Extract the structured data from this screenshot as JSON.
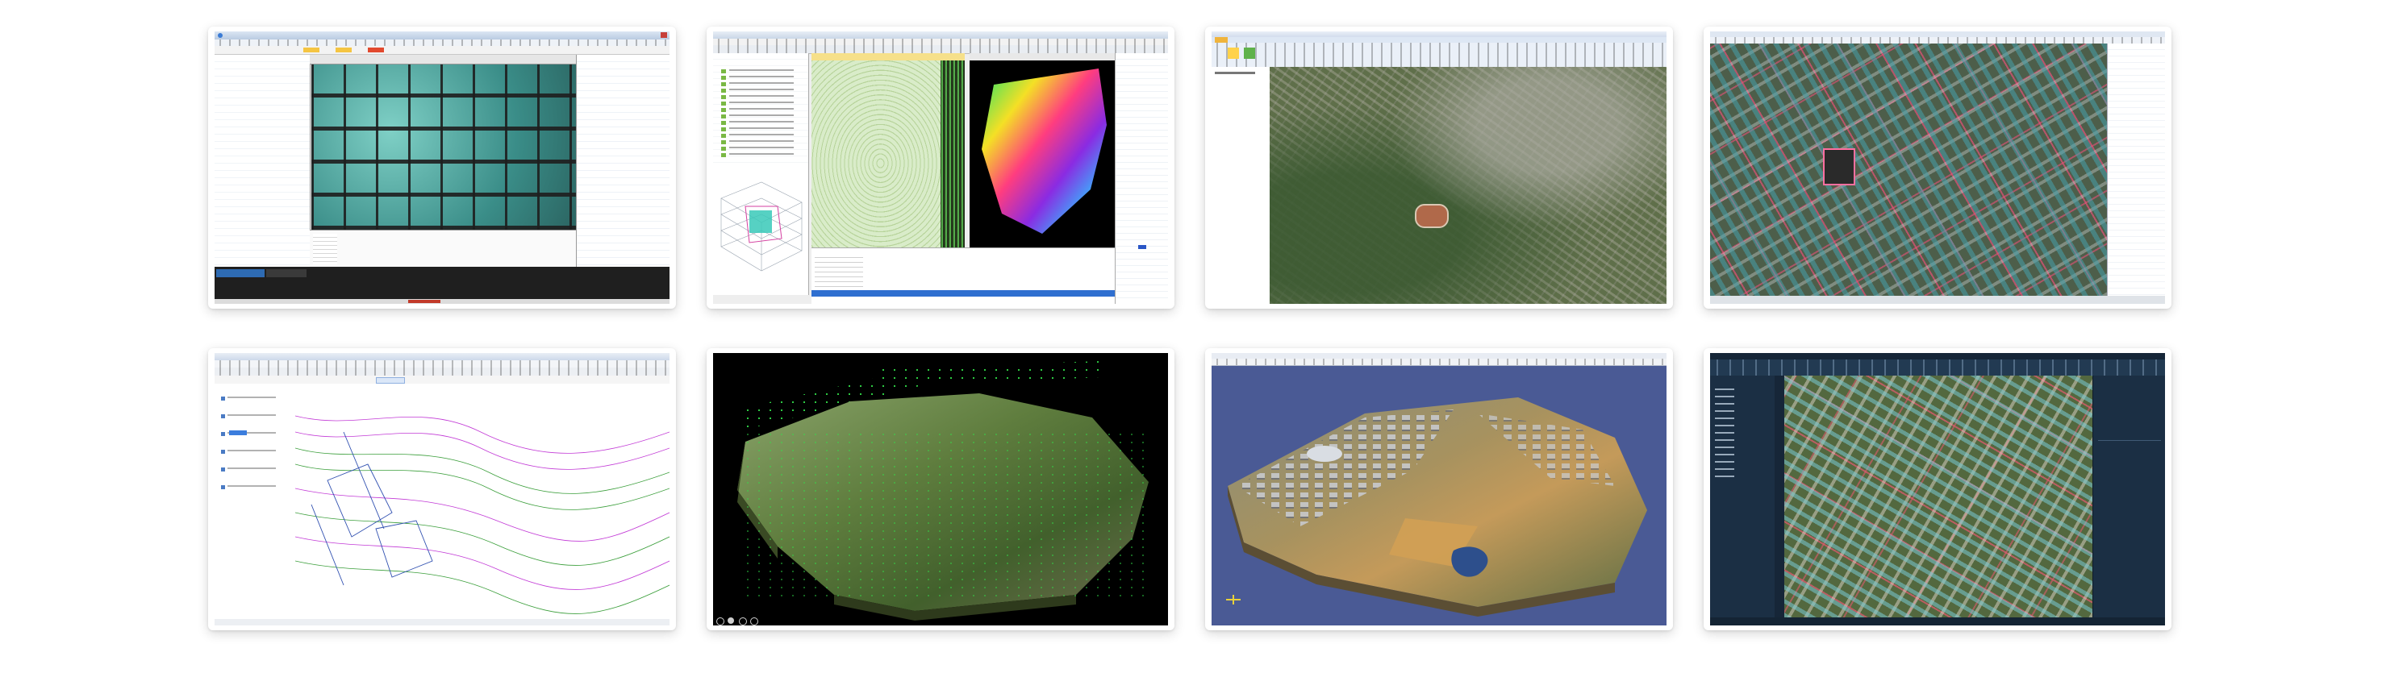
{
  "screenshots": [
    {
      "name": "image-mosaic-software-screenshot"
    },
    {
      "name": "terrain-processing-software-screenshot"
    },
    {
      "name": "aerial-imagery-viewer-screenshot"
    },
    {
      "name": "building-vector-overlay-screenshot"
    },
    {
      "name": "contour-map-editor-screenshot"
    },
    {
      "name": "3d-point-cloud-terrain-screenshot"
    },
    {
      "name": "3d-city-model-screenshot"
    },
    {
      "name": "dark-theme-map-editor-screenshot"
    }
  ]
}
